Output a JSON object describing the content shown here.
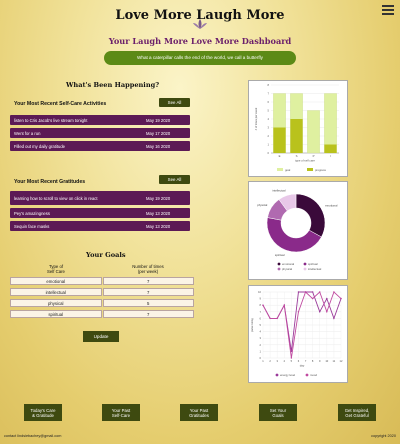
{
  "header": {
    "brand": "Love More Laugh More",
    "dashboard_title": "Your Laugh More Love More Dashboard",
    "quote": "What a caterpillar calls the end of the world, we call a butterfly"
  },
  "happening": {
    "title": "What's Been Happening?"
  },
  "selfcare": {
    "title": "Your Most Recent Self-Care Activities",
    "see_all": "See All",
    "items": [
      {
        "text": "listen to Cris Jacob's live stream tonight",
        "date": "May 19 2020"
      },
      {
        "text": "Went for a run",
        "date": "May 17 2020"
      },
      {
        "text": "Filled out my daily gratitude",
        "date": "May 16 2020"
      }
    ]
  },
  "gratitudes": {
    "title": "Your Most Recent Gratitudes",
    "see_all": "See All",
    "items": [
      {
        "text": "learning how to scroll to view on click in react",
        "date": "May 19 2020"
      },
      {
        "text": "Pey's amazingness",
        "date": "May 13 2020"
      },
      {
        "text": "Sequin face masks",
        "date": "May 13 2020"
      }
    ]
  },
  "goals": {
    "title": "Your Goals",
    "col1": "Type of\nSelf Care",
    "col2": "Number of times\n(per week)",
    "rows": [
      {
        "type": "emotional",
        "count": "7"
      },
      {
        "type": "intellectual",
        "count": "7"
      },
      {
        "type": "physical",
        "count": "5"
      },
      {
        "type": "spiritual",
        "count": "7"
      }
    ],
    "update": "Update"
  },
  "charts": {
    "colors": {
      "goal": "#dff0a0",
      "progress": "#b9c21c",
      "emotional": "#3a0a3a",
      "spiritual": "#8a2a8a",
      "physical": "#b06ab0",
      "intellectual": "#e8c8e8",
      "line1": "#9a3a9a",
      "line2": "#c04aa0"
    }
  },
  "chart_data": [
    {
      "type": "bar",
      "xlabel": "type of self care",
      "ylabel": "# of times per week",
      "categories": [
        "E",
        "S",
        "P",
        "I"
      ],
      "ylim": [
        0,
        8
      ],
      "yticks": [
        "0",
        "1",
        "2",
        "3",
        "4",
        "5",
        "6",
        "7",
        "8"
      ],
      "series": [
        {
          "name": "goal",
          "values": [
            7,
            7,
            5,
            7
          ]
        },
        {
          "name": "progress",
          "values": [
            3,
            4,
            0,
            1
          ]
        }
      ],
      "legend": "bottom"
    },
    {
      "type": "pie",
      "labels": [
        "emotional",
        "spiritual",
        "physical",
        "intellectual"
      ],
      "values": [
        33,
        45,
        12,
        10
      ],
      "legend": "bottom"
    },
    {
      "type": "line",
      "xlabel": "day",
      "ylabel": "pulse rating",
      "x": [
        1,
        2,
        3,
        4,
        5,
        6,
        7,
        8,
        9,
        10,
        11,
        12
      ],
      "ylim": [
        0,
        10
      ],
      "yticks": [
        "0",
        "1",
        "2",
        "3",
        "4",
        "5",
        "6",
        "7",
        "8",
        "9",
        "10"
      ],
      "series": [
        {
          "name": "energy level",
          "values": [
            8,
            6,
            6,
            8,
            1,
            10,
            10,
            10,
            7,
            9,
            6,
            9
          ]
        },
        {
          "name": "mood",
          "values": [
            8,
            6,
            6,
            8,
            0,
            7,
            10,
            9,
            10,
            7,
            10,
            9
          ]
        }
      ],
      "legend": "bottom"
    }
  ],
  "bottom_nav": [
    "Today's Care\n& Gratitude",
    "Your Past\nSelf-Care",
    "Your Past\nGratitudes",
    "Set Your\nGoals",
    "Get Inspired,\nGet Grateful"
  ],
  "footer": {
    "contact": "contact lindsiebachey@gmail.com",
    "copyright": "copyright 2020"
  }
}
